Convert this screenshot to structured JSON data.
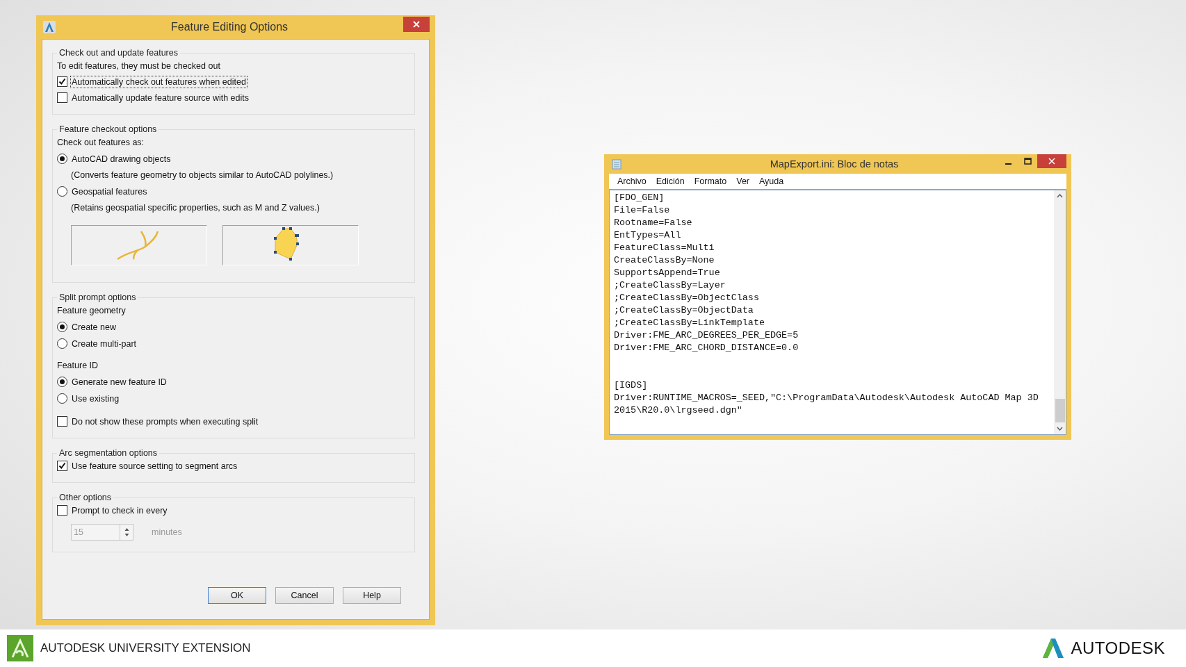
{
  "dialog": {
    "title": "Feature Editing Options",
    "sections": [
      {
        "title": "Check out and update features",
        "items": [
          {
            "kind": "text",
            "label": "To edit features, they must be checked out"
          },
          {
            "kind": "checkbox",
            "label": "Automatically check out features when edited",
            "checked": true,
            "focused": true
          },
          {
            "kind": "checkbox",
            "label": "Automatically update feature source with edits",
            "checked": false,
            "focused": false
          }
        ]
      },
      {
        "title": "Feature checkout options",
        "items": [
          {
            "kind": "text",
            "label": "Check out features as:"
          },
          {
            "kind": "radio",
            "label": "AutoCAD drawing objects",
            "selected": true
          },
          {
            "kind": "note",
            "label": "(Converts feature geometry to objects similar to AutoCAD polylines.)"
          },
          {
            "kind": "radio",
            "label": "Geospatial features",
            "selected": false
          },
          {
            "kind": "note",
            "label": "(Retains geospatial specific properties, such as M and Z values.)"
          },
          {
            "kind": "previews"
          }
        ]
      },
      {
        "title": "Split prompt options",
        "items": [
          {
            "kind": "text",
            "label": "Feature geometry"
          },
          {
            "kind": "radio",
            "label": "Create new",
            "selected": true
          },
          {
            "kind": "radio",
            "label": "Create multi-part",
            "selected": false
          },
          {
            "kind": "text",
            "label": "Feature ID"
          },
          {
            "kind": "radio",
            "label": "Generate new feature ID",
            "selected": true
          },
          {
            "kind": "radio",
            "label": "Use existing",
            "selected": false
          },
          {
            "kind": "checkbox",
            "label": "Do not show these prompts when executing split",
            "checked": false,
            "focused": false
          }
        ]
      },
      {
        "title": "Arc segmentation options",
        "items": [
          {
            "kind": "checkbox",
            "label": "Use feature source setting to segment arcs",
            "checked": true,
            "focused": false
          }
        ]
      },
      {
        "title": "Other options",
        "items": [
          {
            "kind": "checkbox",
            "label": "Prompt to check in every",
            "checked": false,
            "focused": false
          },
          {
            "kind": "spinner",
            "value": "15",
            "unit": "minutes",
            "disabled": true
          }
        ]
      }
    ],
    "buttons": [
      {
        "label": "OK",
        "default": true
      },
      {
        "label": "Cancel",
        "default": false
      },
      {
        "label": "Help",
        "default": false
      }
    ]
  },
  "notepad": {
    "title": "MapExport.ini: Bloc de notas",
    "menu": [
      "Archivo",
      "Edición",
      "Formato",
      "Ver",
      "Ayuda"
    ],
    "blocks": [
      [
        "[FDO_GEN]",
        "File=False",
        "Rootname=False",
        "EntTypes=All",
        "FeatureClass=Multi",
        "CreateClassBy=None",
        "SupportsAppend=True",
        ";CreateClassBy=Layer",
        ";CreateClassBy=ObjectClass",
        ";CreateClassBy=ObjectData",
        ";CreateClassBy=LinkTemplate",
        "Driver:FME_ARC_DEGREES_PER_EDGE=5",
        "Driver:FME_ARC_CHORD_DISTANCE=0.0"
      ],
      [
        "[IGDS]",
        "Driver:RUNTIME_MACROS=_SEED,\"C:\\ProgramData\\Autodesk\\Autodesk AutoCAD Map 3D",
        "2015\\R20.0\\lrgseed.dgn\""
      ]
    ]
  },
  "footer": {
    "brand": "AUTODESK UNIVERSITY EXTENSION",
    "logo": "AUTODESK"
  }
}
